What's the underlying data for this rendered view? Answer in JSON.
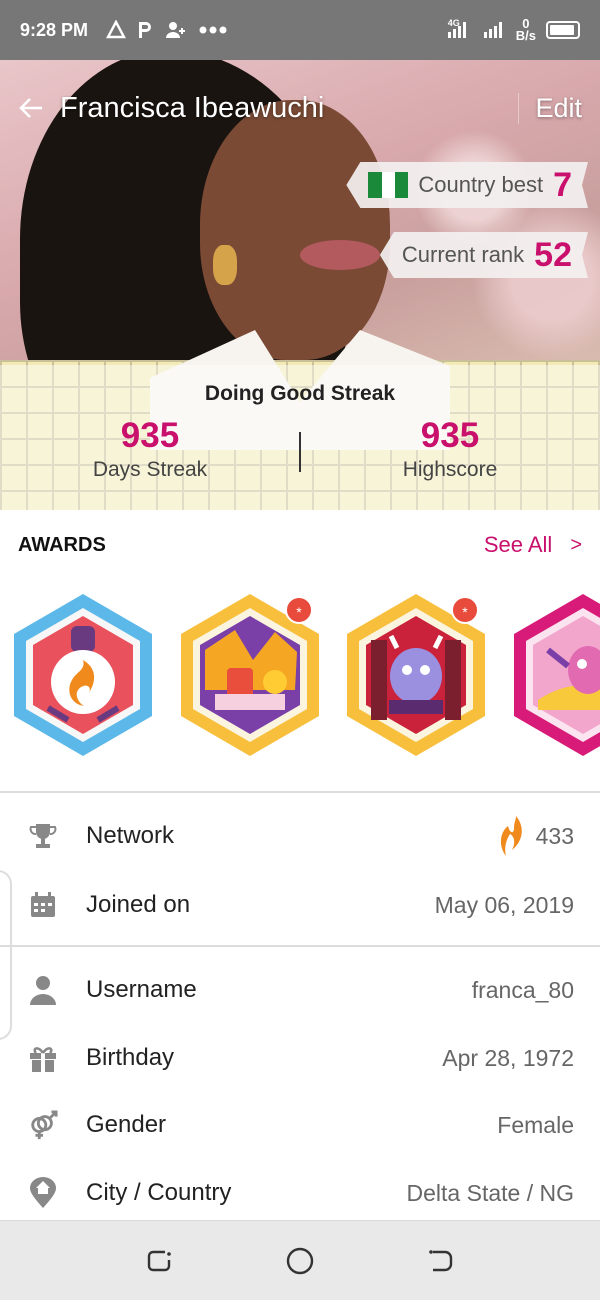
{
  "status_bar": {
    "time": "9:28 PM",
    "left_icons": [
      "warning-triangle-icon",
      "parking-icon",
      "add-user-icon",
      "more-dots-icon"
    ],
    "net_speed_value": "0",
    "net_speed_unit": "B/s",
    "network": "4G"
  },
  "profile": {
    "name": "Francisca Ibeawuchi",
    "edit_label": "Edit",
    "country_best_label": "Country best",
    "country_best_value": "7",
    "current_rank_label": "Current rank",
    "current_rank_value": "52",
    "flag_colors": [
      "#1a8a3a",
      "#ffffff",
      "#1a8a3a"
    ]
  },
  "streak": {
    "title": "Doing Good Streak",
    "days_value": "935",
    "days_label": "Days Streak",
    "highscore_value": "935",
    "highscore_label": "Highscore"
  },
  "awards": {
    "title": "AWARDS",
    "see_all": "See All",
    "chevron": ">",
    "badges": [
      {
        "name": "flame-award",
        "frame_color": "#5bb8e8",
        "is_new": false
      },
      {
        "name": "festival-award",
        "frame_color": "#f7bf3b",
        "is_new": true
      },
      {
        "name": "monster-stage-award",
        "frame_color": "#f7bf3b",
        "is_new": true
      },
      {
        "name": "music-award",
        "frame_color": "#d81b78",
        "is_new": false
      }
    ],
    "new_marker": "*"
  },
  "info": {
    "network": {
      "label": "Network",
      "value": "433"
    },
    "joined": {
      "label": "Joined on",
      "value": "May 06, 2019"
    },
    "username": {
      "label": "Username",
      "value": "franca_80"
    },
    "birthday": {
      "label": "Birthday",
      "value": "Apr 28, 1972"
    },
    "gender": {
      "label": "Gender",
      "value": "Female"
    },
    "city": {
      "label": "City / Country",
      "value": "Delta State / NG"
    }
  },
  "colors": {
    "accent": "#c8106c",
    "flame": "#f08a1c"
  }
}
